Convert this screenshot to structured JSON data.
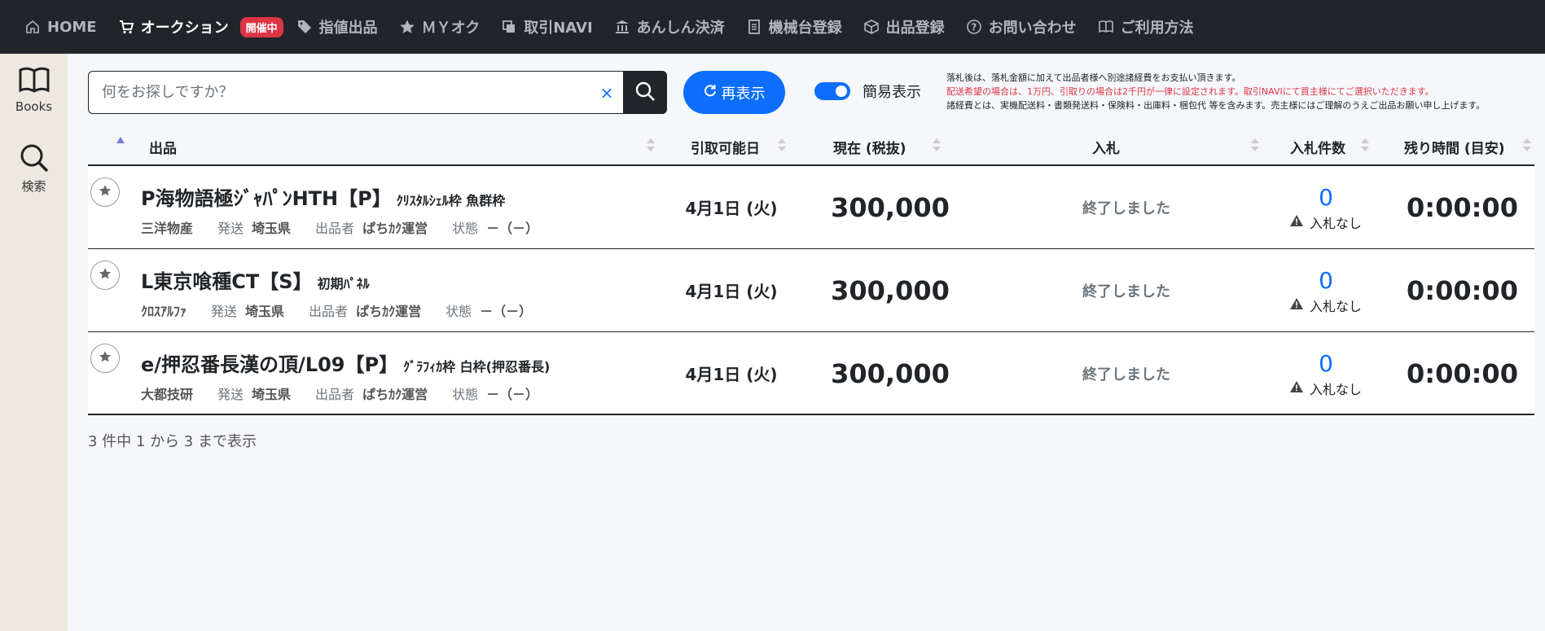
{
  "nav": {
    "home": "HOME",
    "auction": "オークション",
    "auction_badge": "開催中",
    "fixed_price": "指値出品",
    "my_auction": "ＭＹオク",
    "trade_navi": "取引NAVI",
    "safe_payment": "あんしん決済",
    "machine_reg": "機械台登録",
    "listing_reg": "出品登録",
    "contact": "お問い合わせ",
    "guide": "ご利用方法"
  },
  "sidebar": {
    "books": "Books",
    "search": "検索"
  },
  "search": {
    "placeholder": "何をお探しですか？",
    "clear": "×"
  },
  "refresh_label": "再表示",
  "simple_view_label": "簡易表示",
  "notice": {
    "line1": "落札後は、落札金額に加えて出品者様へ別途諸経費をお支払い頂きます。",
    "line2": "配送希望の場合は、1万円、引取りの場合は2千円が一律に設定されます。取引NAVIにて買主様にてご選択いただきます。",
    "line3": "諸経費とは、実機配送料・書類発送料・保険料・出庫料・梱包代 等を含みます。売主様にはご理解のうえご出品お願い申し上げます。"
  },
  "table": {
    "headers": {
      "item": "出品",
      "pickup": "引取可能日",
      "current": "現在 (税抜)",
      "bid": "入札",
      "bid_count": "入札件数",
      "remaining": "残り時間 (目安)"
    },
    "rows": [
      {
        "title": "P海物語極ｼﾞｬﾊﾟﾝHTH【P】",
        "subtitle": "ｸﾘｽﾀﾙｼｪﾙ枠 魚群枠",
        "maker": "三洋物産",
        "ship_label": "発送",
        "ship": "埼玉県",
        "seller_label": "出品者",
        "seller": "ぱちｶｸ運営",
        "state_label": "状態",
        "state": "－（－）",
        "pickup": "4月1日 (火)",
        "price": "300,000",
        "status": "終了しました",
        "bid_count": "0",
        "no_bid": "入札なし",
        "remaining": "0:00:00"
      },
      {
        "title": "L東京喰種CT【S】",
        "subtitle": "初期ﾊﾟﾈﾙ",
        "maker": "ｸﾛｽｱﾙﾌｧ",
        "ship_label": "発送",
        "ship": "埼玉県",
        "seller_label": "出品者",
        "seller": "ぱちｶｸ運営",
        "state_label": "状態",
        "state": "－（－）",
        "pickup": "4月1日 (火)",
        "price": "300,000",
        "status": "終了しました",
        "bid_count": "0",
        "no_bid": "入札なし",
        "remaining": "0:00:00"
      },
      {
        "title": "e/押忍番長漢の頂/L09【P】",
        "subtitle": "ｸﾞﾗﾌｨｶ枠 白枠(押忍番長)",
        "maker": "大都技研",
        "ship_label": "発送",
        "ship": "埼玉県",
        "seller_label": "出品者",
        "seller": "ぱちｶｸ運営",
        "state_label": "状態",
        "state": "－（－）",
        "pickup": "4月1日 (火)",
        "price": "300,000",
        "status": "終了しました",
        "bid_count": "0",
        "no_bid": "入札なし",
        "remaining": "0:00:00"
      }
    ]
  },
  "footer_text": "3 件中 1 から 3 まで表示"
}
